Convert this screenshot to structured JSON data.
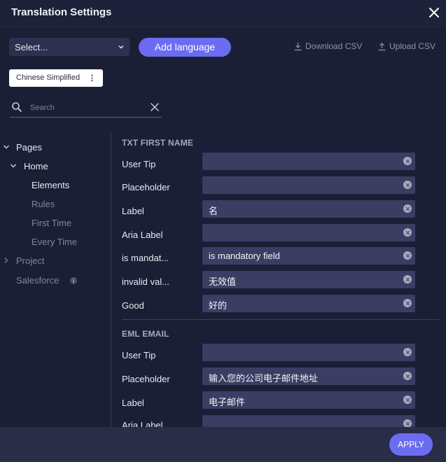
{
  "dialog": {
    "title": "Translation Settings"
  },
  "toolbar": {
    "language_select": "Select...",
    "add_language": "Add language",
    "download_csv": "Download CSV",
    "upload_csv": "Upload CSV"
  },
  "language_chip": {
    "label": "Chinese Simplified",
    "menu_glyph": "⋮"
  },
  "search": {
    "placeholder": "Search"
  },
  "tree": {
    "pages": "Pages",
    "home": "Home",
    "elements": "Elements",
    "rules": "Rules",
    "first_time": "First Time",
    "every_time": "Every Time",
    "project": "Project",
    "salesforce": "Salesforce"
  },
  "sections": [
    {
      "title": "TXT FIRST NAME",
      "rows": [
        {
          "label": "User Tip",
          "value": ""
        },
        {
          "label": "Placeholder",
          "value": ""
        },
        {
          "label": "Label",
          "value": "名"
        },
        {
          "label": "Aria Label",
          "value": ""
        },
        {
          "label": "is mandat...",
          "value": "is mandatory field"
        },
        {
          "label": "invalid val...",
          "value": "无效值"
        },
        {
          "label": "Good",
          "value": "好的"
        }
      ]
    },
    {
      "title": "EML EMAIL",
      "rows": [
        {
          "label": "User Tip",
          "value": ""
        },
        {
          "label": "Placeholder",
          "value": "输入您的公司电子邮件地址"
        },
        {
          "label": "Label",
          "value": "电子邮件"
        },
        {
          "label": "Aria Label",
          "value": ""
        }
      ]
    }
  ],
  "footer": {
    "apply": "APPLY"
  },
  "colors": {
    "accent": "#6b6cf1",
    "background": "#1b1f36",
    "field": "#3b3d62"
  }
}
